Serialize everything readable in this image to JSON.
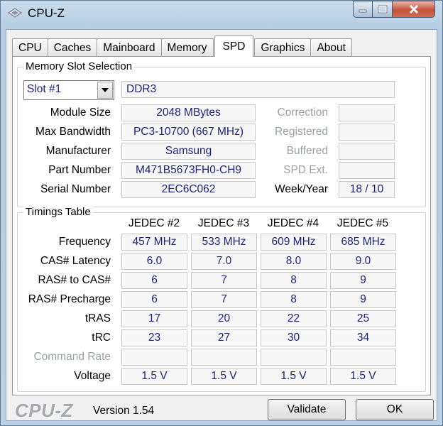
{
  "window": {
    "title": "CPU-Z"
  },
  "tabs": [
    "CPU",
    "Caches",
    "Mainboard",
    "Memory",
    "SPD",
    "Graphics",
    "About"
  ],
  "active_tab": "SPD",
  "slot_group": {
    "title": "Memory Slot Selection",
    "slot_value": "Slot #1",
    "memory_type": "DDR3",
    "module_size_label": "Module Size",
    "module_size": "2048 MBytes",
    "max_bandwidth_label": "Max Bandwidth",
    "max_bandwidth": "PC3-10700 (667 MHz)",
    "manufacturer_label": "Manufacturer",
    "manufacturer": "Samsung",
    "part_number_label": "Part Number",
    "part_number": "M471B5673FH0-CH9",
    "serial_number_label": "Serial Number",
    "serial_number": "2EC6C062",
    "correction_label": "Correction",
    "correction": "",
    "registered_label": "Registered",
    "registered": "",
    "buffered_label": "Buffered",
    "buffered": "",
    "spd_ext_label": "SPD Ext.",
    "spd_ext": "",
    "week_year_label": "Week/Year",
    "week_year": "18 / 10"
  },
  "timings": {
    "title": "Timings Table",
    "columns": [
      "JEDEC #2",
      "JEDEC #3",
      "JEDEC #4",
      "JEDEC #5"
    ],
    "rows": [
      {
        "label": "Frequency",
        "values": [
          "457 MHz",
          "533 MHz",
          "609 MHz",
          "685 MHz"
        ],
        "disabled": false
      },
      {
        "label": "CAS# Latency",
        "values": [
          "6.0",
          "7.0",
          "8.0",
          "9.0"
        ],
        "disabled": false
      },
      {
        "label": "RAS# to CAS#",
        "values": [
          "6",
          "7",
          "8",
          "9"
        ],
        "disabled": false
      },
      {
        "label": "RAS# Precharge",
        "values": [
          "6",
          "7",
          "8",
          "9"
        ],
        "disabled": false
      },
      {
        "label": "tRAS",
        "values": [
          "17",
          "20",
          "22",
          "25"
        ],
        "disabled": false
      },
      {
        "label": "tRC",
        "values": [
          "23",
          "27",
          "30",
          "34"
        ],
        "disabled": false
      },
      {
        "label": "Command Rate",
        "values": [
          "",
          "",
          "",
          ""
        ],
        "disabled": true
      },
      {
        "label": "Voltage",
        "values": [
          "1.5 V",
          "1.5 V",
          "1.5 V",
          "1.5 V"
        ],
        "disabled": false
      }
    ]
  },
  "footer": {
    "brand": "CPU-Z",
    "version": "Version 1.54",
    "validate_label": "Validate",
    "ok_label": "OK"
  }
}
